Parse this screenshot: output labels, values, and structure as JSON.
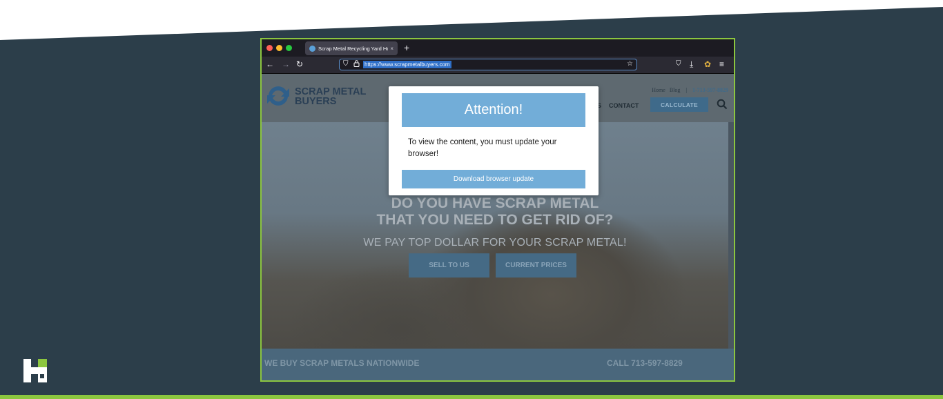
{
  "browser": {
    "tab_title": "Scrap Metal Recycling Yard Hou",
    "tab_close": "×",
    "new_tab": "+",
    "url": "https://www.scrapmetalbuyers.com",
    "icons": {
      "back": "←",
      "forward": "→",
      "reload": "↻",
      "shield": "⛉",
      "lock": "🔒",
      "star": "☆",
      "pocket": "⛉",
      "download": "⤓",
      "extension": "✿",
      "menu": "≡"
    }
  },
  "site": {
    "logo_line1": "SCRAP METAL",
    "logo_line2": "BUYERS",
    "toplinks": {
      "home": "Home",
      "blog": "Blog",
      "separator": "|",
      "phone": "1-713-597-8829"
    },
    "nav_partial": "S",
    "nav_contact": "CONTACT",
    "calculate_label": "CALCULATE"
  },
  "hero": {
    "headline_line1": "DO YOU HAVE SCRAP METAL",
    "headline_line2": "THAT YOU NEED TO GET RID OF?",
    "subheadline": "WE PAY TOP DOLLAR FOR YOUR SCRAP METAL!",
    "sell_label": "SELL TO US",
    "prices_label": "CURRENT PRICES"
  },
  "footer": {
    "left_text": "WE BUY SCRAP METALS NATIONWIDE",
    "right_text": "CALL 713-597-8829"
  },
  "modal": {
    "title": "Attention!",
    "message": "To view the content, you must update your browser!",
    "button_label": "Download browser update"
  },
  "colors": {
    "background": "#2c3e4a",
    "accent_green": "#8cc63f",
    "modal_blue": "#72add8"
  }
}
